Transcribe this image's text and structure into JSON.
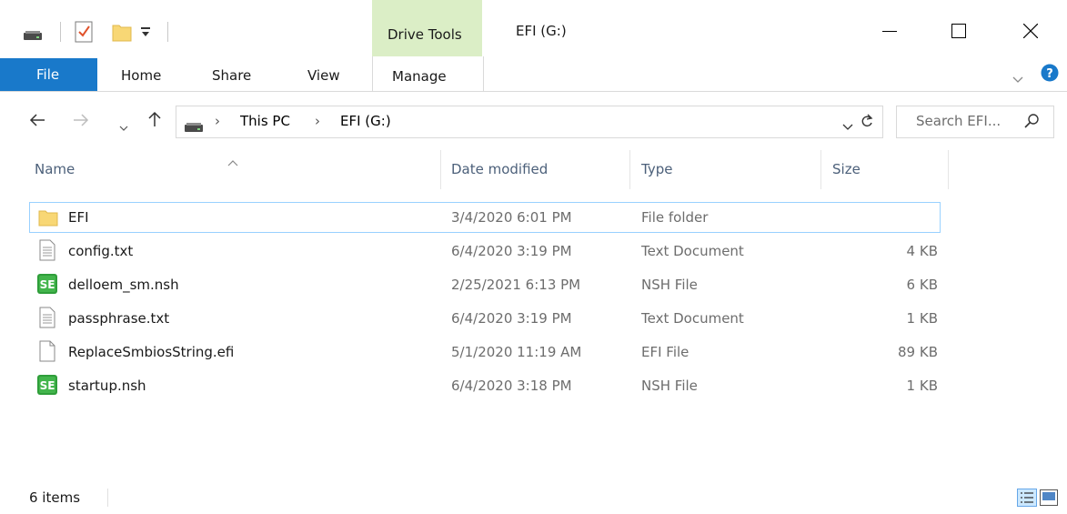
{
  "window": {
    "title": "EFI (G:)",
    "contextual_tab_group": "Drive Tools"
  },
  "ribbon": {
    "tabs": [
      "File",
      "Home",
      "Share",
      "View",
      "Manage"
    ]
  },
  "address": {
    "crumbs": [
      "This PC",
      "EFI (G:)"
    ],
    "search_placeholder": "Search EFI..."
  },
  "columns": {
    "name": "Name",
    "date": "Date modified",
    "type": "Type",
    "size": "Size"
  },
  "files": [
    {
      "name": "EFI",
      "date": "3/4/2020 6:01 PM",
      "type": "File folder",
      "size": "",
      "icon": "folder-icon"
    },
    {
      "name": "config.txt",
      "date": "6/4/2020 3:19 PM",
      "type": "Text Document",
      "size": "4 KB",
      "icon": "text-file-icon"
    },
    {
      "name": "delloem_sm.nsh",
      "date": "2/25/2021 6:13 PM",
      "type": "NSH File",
      "size": "6 KB",
      "icon": "nsh-file-icon"
    },
    {
      "name": "passphrase.txt",
      "date": "6/4/2020 3:19 PM",
      "type": "Text Document",
      "size": "1 KB",
      "icon": "text-file-icon"
    },
    {
      "name": "ReplaceSmbiosString.efi",
      "date": "5/1/2020 11:19 AM",
      "type": "EFI File",
      "size": "89 KB",
      "icon": "blank-file-icon"
    },
    {
      "name": "startup.nsh",
      "date": "6/4/2020 3:18 PM",
      "type": "NSH File",
      "size": "1 KB",
      "icon": "nsh-file-icon"
    }
  ],
  "status": {
    "item_count": "6 items"
  },
  "colors": {
    "file_tab": "#1979ca",
    "drive_tools": "#dbeec6",
    "selection_border": "#99d1ff",
    "header_text": "#4c607a"
  }
}
